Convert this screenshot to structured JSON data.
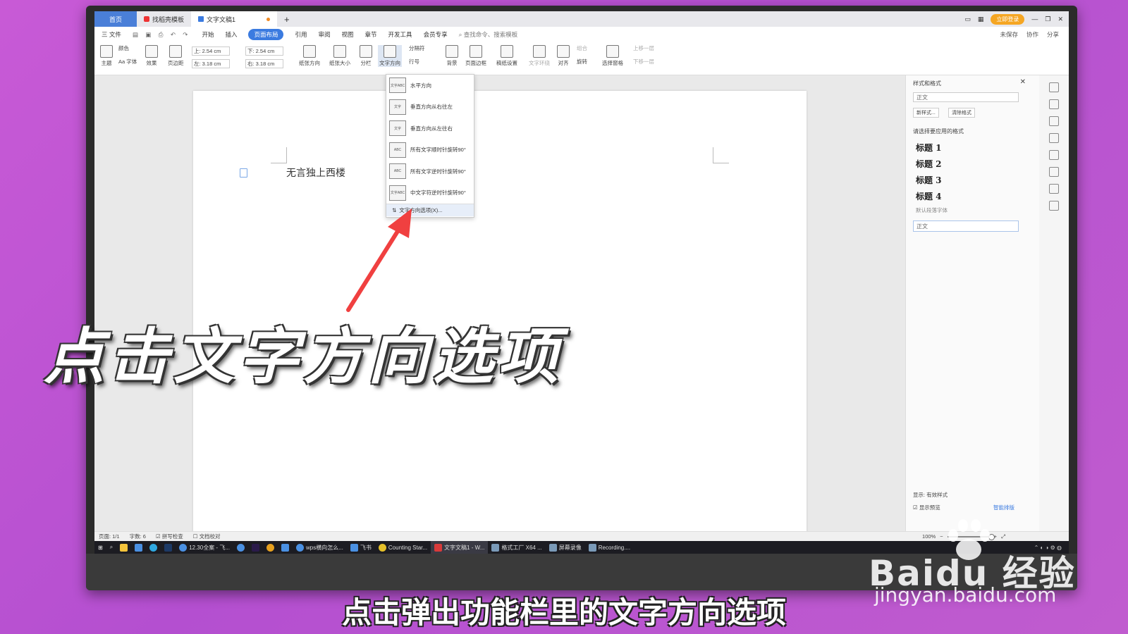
{
  "window": {
    "tabs": [
      {
        "label": "首页"
      },
      {
        "label": "找稻壳模板"
      },
      {
        "label": "文字文稿1"
      }
    ],
    "add_tab": "+",
    "login_label": "立即登录"
  },
  "menubar": {
    "file": "三 文件",
    "items": [
      "开始",
      "插入",
      "页面布局",
      "引用",
      "审阅",
      "视图",
      "章节",
      "开发工具",
      "会员专享"
    ],
    "search_placeholder": "查找命令、搜索模板",
    "right_items": [
      "未保存",
      "协作",
      "分享"
    ]
  },
  "toolbar": {
    "theme": "主题",
    "colors": "颜色",
    "fonts": "Aa 字体",
    "effects": "效果",
    "margins": "页边距",
    "margin_top": "上: 2.54 cm",
    "margin_bottom": "下: 2.54 cm",
    "margin_left": "左: 3.18 cm",
    "margin_right": "右: 3.18 cm",
    "orientation": "纸张方向",
    "size": "纸张大小",
    "columns": "分栏",
    "text_direction": "文字方向",
    "breaks": "分隔符",
    "line_numbers": "行号",
    "background": "背景",
    "page_border": "页面边框",
    "manuscript": "稿纸设置",
    "wrap": "文字环绕",
    "align": "对齐",
    "group": "组合",
    "rotate": "旋转",
    "selection_pane": "选择窗格",
    "bring_forward": "上移一层",
    "send_backward": "下移一层"
  },
  "document": {
    "text": "无言独上西楼"
  },
  "dropdown": {
    "items": [
      {
        "label": "水平方向",
        "icon_text": "文字ABC"
      },
      {
        "label": "垂直方向从右往左",
        "icon_text": "文字"
      },
      {
        "label": "垂直方向从左往右",
        "icon_text": "文字"
      },
      {
        "label": "所有文字顺时针旋转90°",
        "icon_text": "ABC"
      },
      {
        "label": "所有文字逆时针旋转90°",
        "icon_text": "ABC"
      },
      {
        "label": "中文字符逆时针旋转90°",
        "icon_text": "文字ABC"
      }
    ],
    "options_label": "文字方向选项(X)..."
  },
  "style_panel": {
    "title": "样式和格式",
    "current_style": "正文",
    "new_style": "新样式...",
    "clear_format": "清除格式",
    "choose_label": "请选择要应用的格式",
    "styles": [
      "标题 1",
      "标题 2",
      "标题 3",
      "标题 4"
    ],
    "default_font": "默认段落字体",
    "body_style": "正文",
    "show_label": "显示: 有效样式",
    "preview_label": "显示预览",
    "smart_label": "智能排版"
  },
  "statusbar": {
    "page": "页面: 1/1",
    "words": "字数: 6",
    "spellcheck": "拼写检查",
    "proofread": "文档校对",
    "zoom": "100%"
  },
  "taskbar": {
    "items": [
      "12.30全案 - 飞...",
      "wps横向怎么...",
      "飞书",
      "Counting Star...",
      "文字文稿1 - W...",
      "格式工厂 X64 ...",
      "屏幕录像",
      "Recording...."
    ]
  },
  "overlay": {
    "big_caption": "点击文字方向选项",
    "subtitle": "点击弹出功能栏里的文字方向选项",
    "watermark": "Baidu 经验",
    "watermark_url": "jingyan.baidu.com"
  },
  "colors": {
    "background": "#c85ad6",
    "accent": "#3b7be0",
    "arrow": "#f04040"
  }
}
